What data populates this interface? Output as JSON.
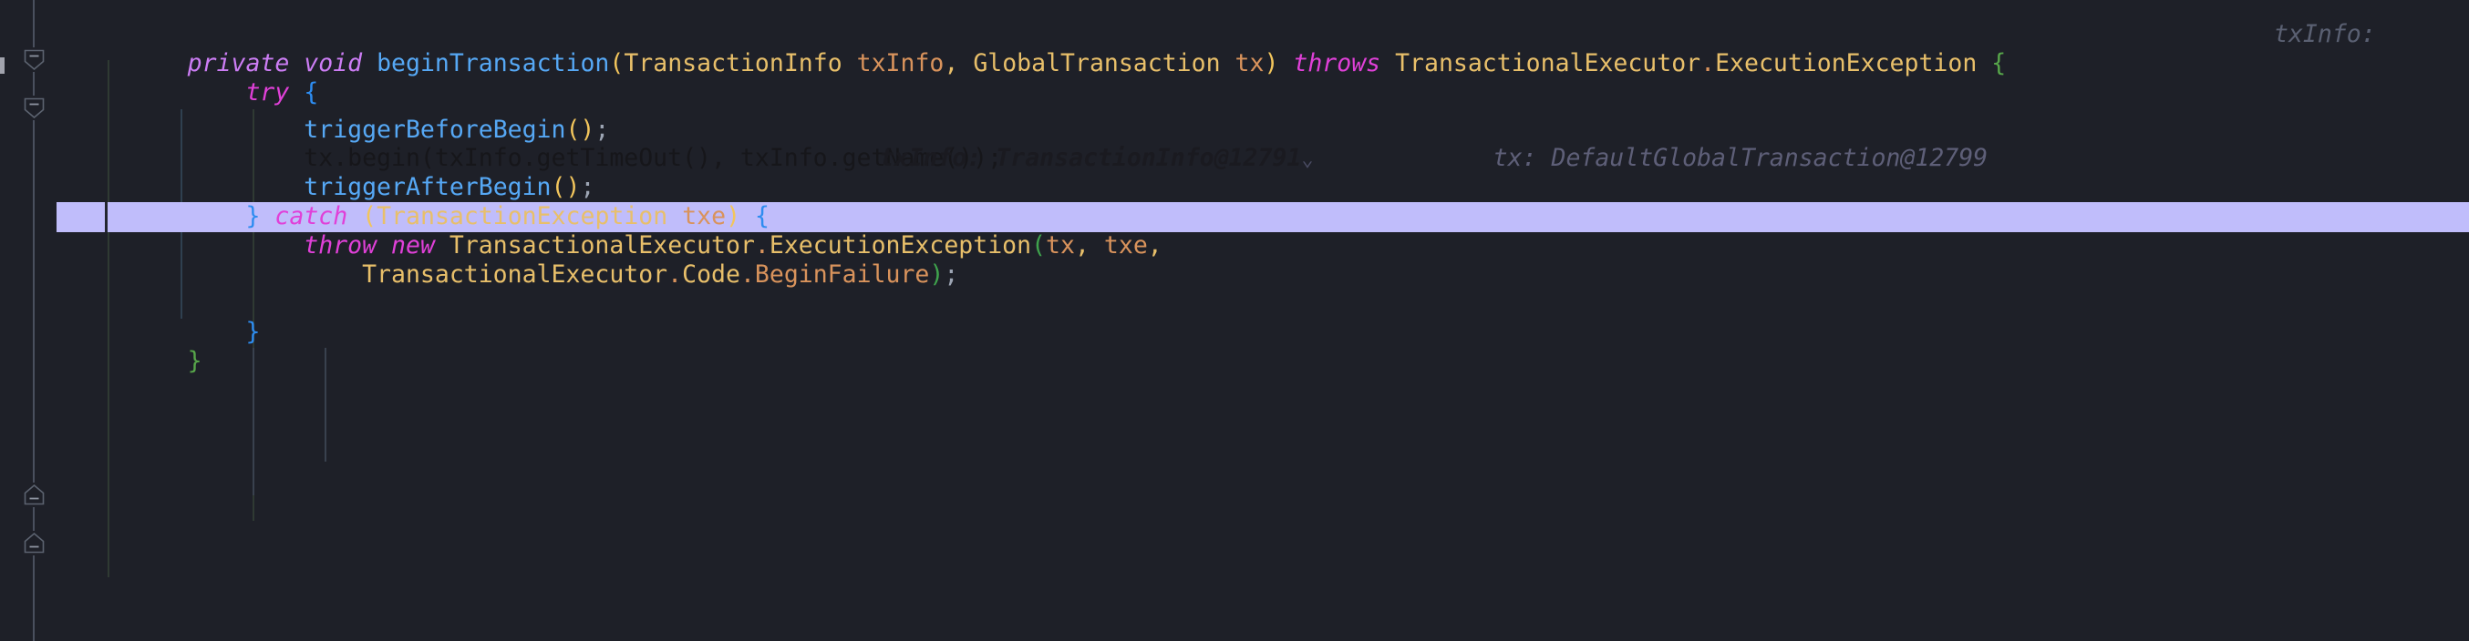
{
  "app": {
    "kind": "code-editor",
    "language": "Java",
    "theme": "Darcula",
    "background": "#1E2028",
    "exec_highlight_color": "#C0BDFB"
  },
  "gutter": {
    "fold_markers": [
      {
        "id": "fold-method-open",
        "direction": "down",
        "tooltip": "Collapse"
      },
      {
        "id": "fold-try-open",
        "direction": "down",
        "tooltip": "Collapse"
      },
      {
        "id": "fold-catch-close",
        "direction": "up",
        "tooltip": "Collapse"
      },
      {
        "id": "fold-method-close",
        "direction": "up",
        "tooltip": "Collapse"
      }
    ]
  },
  "code": {
    "lines": [
      {
        "id": "line-signature",
        "tokens": [
          {
            "t": "private",
            "c": "kw"
          },
          {
            "t": " ",
            "c": "plain"
          },
          {
            "t": "void",
            "c": "kw"
          },
          {
            "t": " ",
            "c": "plain"
          },
          {
            "t": "beginTransaction",
            "c": "mth"
          },
          {
            "t": "(",
            "c": "paren"
          },
          {
            "t": "TransactionInfo",
            "c": "type"
          },
          {
            "t": " ",
            "c": "plain"
          },
          {
            "t": "txInfo",
            "c": "param"
          },
          {
            "t": ",",
            "c": "punc"
          },
          {
            "t": " ",
            "c": "plain"
          },
          {
            "t": "GlobalTransaction",
            "c": "type"
          },
          {
            "t": " ",
            "c": "plain"
          },
          {
            "t": "tx",
            "c": "param"
          },
          {
            "t": ")",
            "c": "paren"
          },
          {
            "t": " ",
            "c": "plain"
          },
          {
            "t": "throws",
            "c": "kw2"
          },
          {
            "t": " ",
            "c": "plain"
          },
          {
            "t": "TransactionalExecutor",
            "c": "type"
          },
          {
            "t": ".",
            "c": "dot"
          },
          {
            "t": "ExecutionException",
            "c": "type"
          },
          {
            "t": " ",
            "c": "plain"
          },
          {
            "t": "{",
            "c": "brace-g"
          }
        ],
        "trailing_hint": "txInfo:"
      },
      {
        "id": "line-try",
        "tokens": [
          {
            "t": "    ",
            "c": "plain"
          },
          {
            "t": "try",
            "c": "kw2"
          },
          {
            "t": " ",
            "c": "plain"
          },
          {
            "t": "{",
            "c": "brace-b"
          }
        ]
      },
      {
        "id": "line-trigger-before-begin",
        "tokens": [
          {
            "t": "        ",
            "c": "plain"
          },
          {
            "t": "triggerBeforeBegin",
            "c": "mth"
          },
          {
            "t": "()",
            "c": "paren"
          },
          {
            "t": ";",
            "c": "semi"
          }
        ]
      },
      {
        "id": "line-tx-begin",
        "executing": true,
        "tokens": [
          {
            "t": "        ",
            "c": "plain"
          },
          {
            "t": "tx.begin(txInfo.getTimeOut(), txInfo.getName());",
            "c": "ex-code"
          }
        ],
        "inline_debug": [
          {
            "label": "txInfo:",
            "value": "TransactionInfo@12791",
            "expandable": true,
            "style": "strong"
          },
          {
            "label": "tx:",
            "value": "DefaultGlobalTransaction@12799",
            "expandable": false,
            "style": "dim"
          }
        ]
      },
      {
        "id": "line-trigger-after-begin",
        "tokens": [
          {
            "t": "        ",
            "c": "plain"
          },
          {
            "t": "triggerAfterBegin",
            "c": "mth"
          },
          {
            "t": "()",
            "c": "paren"
          },
          {
            "t": ";",
            "c": "semi"
          }
        ]
      },
      {
        "id": "line-catch",
        "tokens": [
          {
            "t": "    ",
            "c": "plain"
          },
          {
            "t": "}",
            "c": "brace-b"
          },
          {
            "t": " ",
            "c": "plain"
          },
          {
            "t": "catch",
            "c": "kw2"
          },
          {
            "t": " ",
            "c": "plain"
          },
          {
            "t": "(",
            "c": "paren"
          },
          {
            "t": "TransactionException",
            "c": "type"
          },
          {
            "t": " ",
            "c": "plain"
          },
          {
            "t": "txe",
            "c": "param"
          },
          {
            "t": ")",
            "c": "paren"
          },
          {
            "t": " ",
            "c": "plain"
          },
          {
            "t": "{",
            "c": "brace-b"
          }
        ]
      },
      {
        "id": "line-throw",
        "tokens": [
          {
            "t": "        ",
            "c": "plain"
          },
          {
            "t": "throw",
            "c": "kw2"
          },
          {
            "t": " ",
            "c": "plain"
          },
          {
            "t": "new",
            "c": "kw2"
          },
          {
            "t": " ",
            "c": "plain"
          },
          {
            "t": "TransactionalExecutor",
            "c": "type"
          },
          {
            "t": ".",
            "c": "dot"
          },
          {
            "t": "ExecutionException",
            "c": "type"
          },
          {
            "t": "(",
            "c": "brace-g2"
          },
          {
            "t": "tx",
            "c": "param"
          },
          {
            "t": ",",
            "c": "punc"
          },
          {
            "t": " ",
            "c": "plain"
          },
          {
            "t": "txe",
            "c": "param"
          },
          {
            "t": ",",
            "c": "punc"
          }
        ]
      },
      {
        "id": "line-code-beginfailure",
        "tokens": [
          {
            "t": "            ",
            "c": "plain"
          },
          {
            "t": "TransactionalExecutor",
            "c": "type"
          },
          {
            "t": ".",
            "c": "dot"
          },
          {
            "t": "Code",
            "c": "type"
          },
          {
            "t": ".",
            "c": "dot"
          },
          {
            "t": "BeginFailure",
            "c": "field"
          },
          {
            "t": ")",
            "c": "brace-g2"
          },
          {
            "t": ";",
            "c": "semi"
          }
        ]
      },
      {
        "id": "line-close-catch",
        "tokens": [
          {
            "t": "    ",
            "c": "plain"
          },
          {
            "t": "}",
            "c": "brace-b"
          }
        ]
      },
      {
        "id": "line-close-method",
        "tokens": [
          {
            "t": "}",
            "c": "brace-g"
          }
        ]
      }
    ]
  }
}
